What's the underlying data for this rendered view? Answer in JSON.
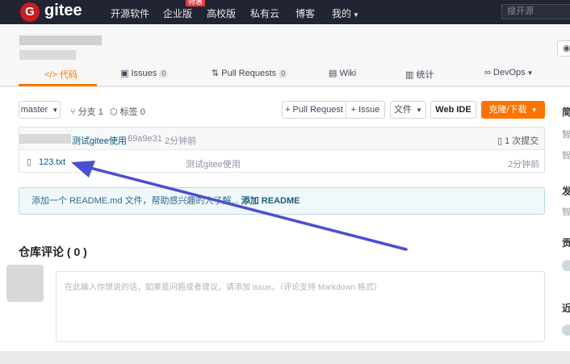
{
  "topnav": {
    "brand": "gitee",
    "logo_letter": "G",
    "items": [
      "开源软件",
      "企业版",
      "高校版",
      "私有云",
      "博客",
      "我的"
    ],
    "hot_badge": "特惠",
    "search_placeholder": "搜开源"
  },
  "tabs": [
    {
      "icon": "</>",
      "label": "代码"
    },
    {
      "icon": "▣",
      "label": "Issues",
      "count": "0"
    },
    {
      "icon": "⇅",
      "label": "Pull Requests",
      "count": "0"
    },
    {
      "icon": "▤",
      "label": "Wiki"
    },
    {
      "icon": "▥",
      "label": "统计"
    },
    {
      "icon": "∞",
      "label": "DevOps"
    }
  ],
  "toolbar": {
    "branch": "master",
    "branches": "分支 1",
    "tags": "标签 0",
    "pull_request": "+ Pull Request",
    "issue": "+ Issue",
    "file": "文件",
    "web_ide": "Web IDE",
    "clone": "克隆/下载"
  },
  "commit": {
    "message": "测试gitee使用",
    "hash": "69a9e31",
    "time": "2分钟前",
    "count": "1 次提交"
  },
  "files": [
    {
      "name": "123.txt",
      "message": "测试gitee使用",
      "time": "2分钟前"
    }
  ],
  "readme": {
    "text": "添加一个 README.md 文件，帮助感兴趣的人了解...",
    "link": "添加 README"
  },
  "comments": {
    "title": "仓库评论 ( 0 )",
    "placeholder": "在此输入你想说的话，如果是问题或者建议，请添加 issue。（评论支持 Markdown 格式）"
  },
  "sidebar": {
    "labels": [
      "简",
      "智",
      "智",
      "发",
      "智",
      "贡",
      "近"
    ]
  },
  "colors": {
    "brand_red": "#c71d23",
    "accent_orange": "#fe7300",
    "arrow_blue": "#4b4fd1"
  }
}
